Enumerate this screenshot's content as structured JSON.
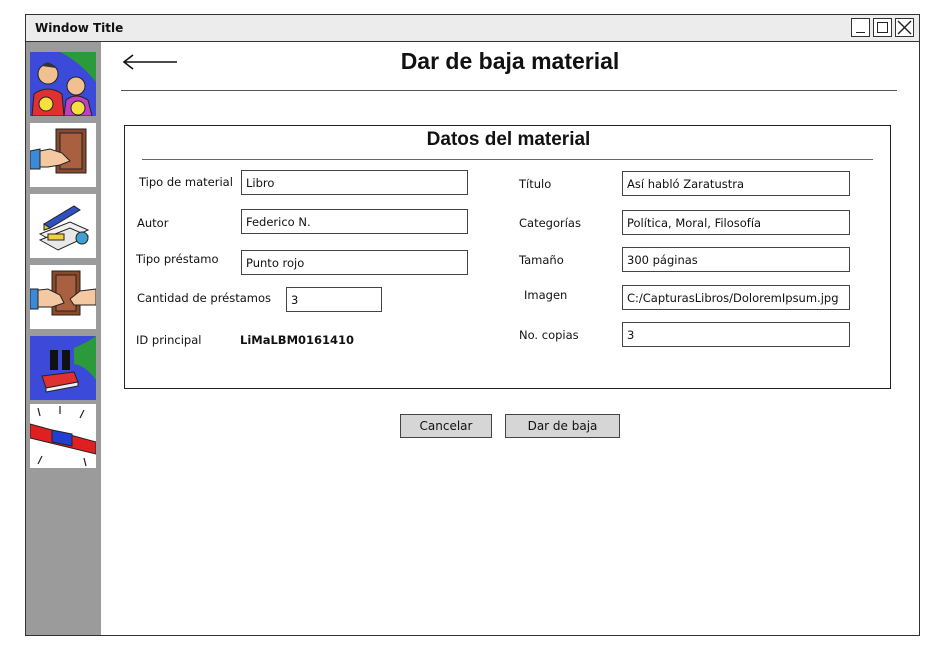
{
  "window": {
    "title": "Window Title"
  },
  "sidebar": {
    "items": [
      {
        "icon": "users-icon"
      },
      {
        "icon": "book-handover-icon"
      },
      {
        "icon": "add-material-icon"
      },
      {
        "icon": "book-exchange-icon"
      },
      {
        "icon": "pause-book-icon"
      },
      {
        "icon": "siren-alert-icon"
      }
    ]
  },
  "header": {
    "title": "Dar de baja material"
  },
  "panel": {
    "title": "Datos del material",
    "left_fields": {
      "tipo_material": {
        "label": "Tipo de material",
        "value": "Libro"
      },
      "autor": {
        "label": "Autor",
        "value": "Federico N."
      },
      "tipo_prestamo": {
        "label": "Tipo préstamo",
        "value": "Punto rojo"
      },
      "cantidad_prestamos": {
        "label": "Cantidad de préstamos",
        "value": "3"
      },
      "id_principal": {
        "label": "ID principal",
        "value": "LiMaLBM0161410"
      }
    },
    "right_fields": {
      "titulo": {
        "label": "Título",
        "value": "Así habló Zaratustra"
      },
      "categorias": {
        "label": "Categorías",
        "value": "Política, Moral, Filosofía"
      },
      "tamano": {
        "label": "Tamaño",
        "value": "300 páginas"
      },
      "imagen": {
        "label": "Imagen",
        "value": "C:/CapturasLibros/DoloremIpsum.jpg"
      },
      "copias": {
        "label": "No. copias",
        "value": "3"
      }
    }
  },
  "actions": {
    "cancel_label": "Cancelar",
    "submit_label": "Dar de baja"
  },
  "colors": {
    "sidebar": "#9b9b9b",
    "button": "#d6d6d6",
    "titlebar": "#ececec"
  }
}
